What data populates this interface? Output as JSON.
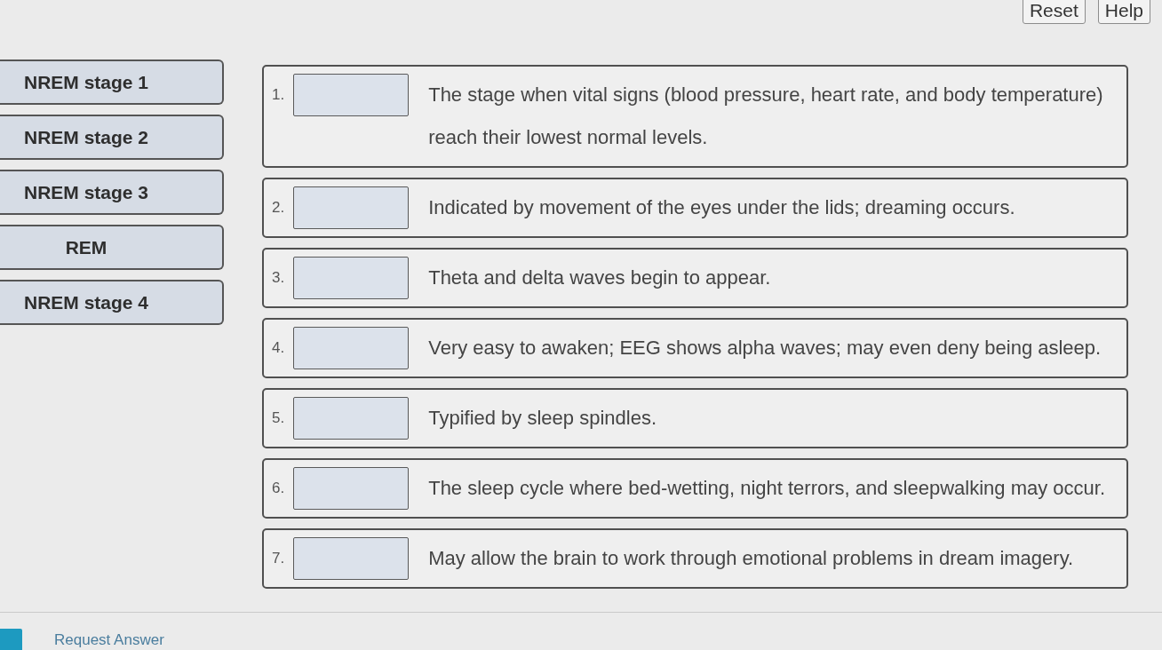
{
  "toolbar": {
    "buttons": [
      "Reset",
      "Help"
    ]
  },
  "terms": [
    "NREM stage 1",
    "NREM stage 2",
    "NREM stage 3",
    "REM",
    "NREM stage 4"
  ],
  "targets": [
    {
      "number": "1.",
      "description": "The stage when vital signs (blood pressure, heart rate, and body temperature) reach their lowest normal levels."
    },
    {
      "number": "2.",
      "description": "Indicated by movement of the eyes under the lids; dreaming occurs."
    },
    {
      "number": "3.",
      "description": "Theta and delta waves begin to appear."
    },
    {
      "number": "4.",
      "description": "Very easy to awaken; EEG shows alpha waves; may even deny being asleep."
    },
    {
      "number": "5.",
      "description": "Typified by sleep spindles."
    },
    {
      "number": "6.",
      "description": "The sleep cycle where bed-wetting, night terrors, and sleepwalking may occur."
    },
    {
      "number": "7.",
      "description": "May allow the brain to work through emotional problems in dream imagery."
    }
  ],
  "footer": {
    "link": "Request Answer"
  }
}
